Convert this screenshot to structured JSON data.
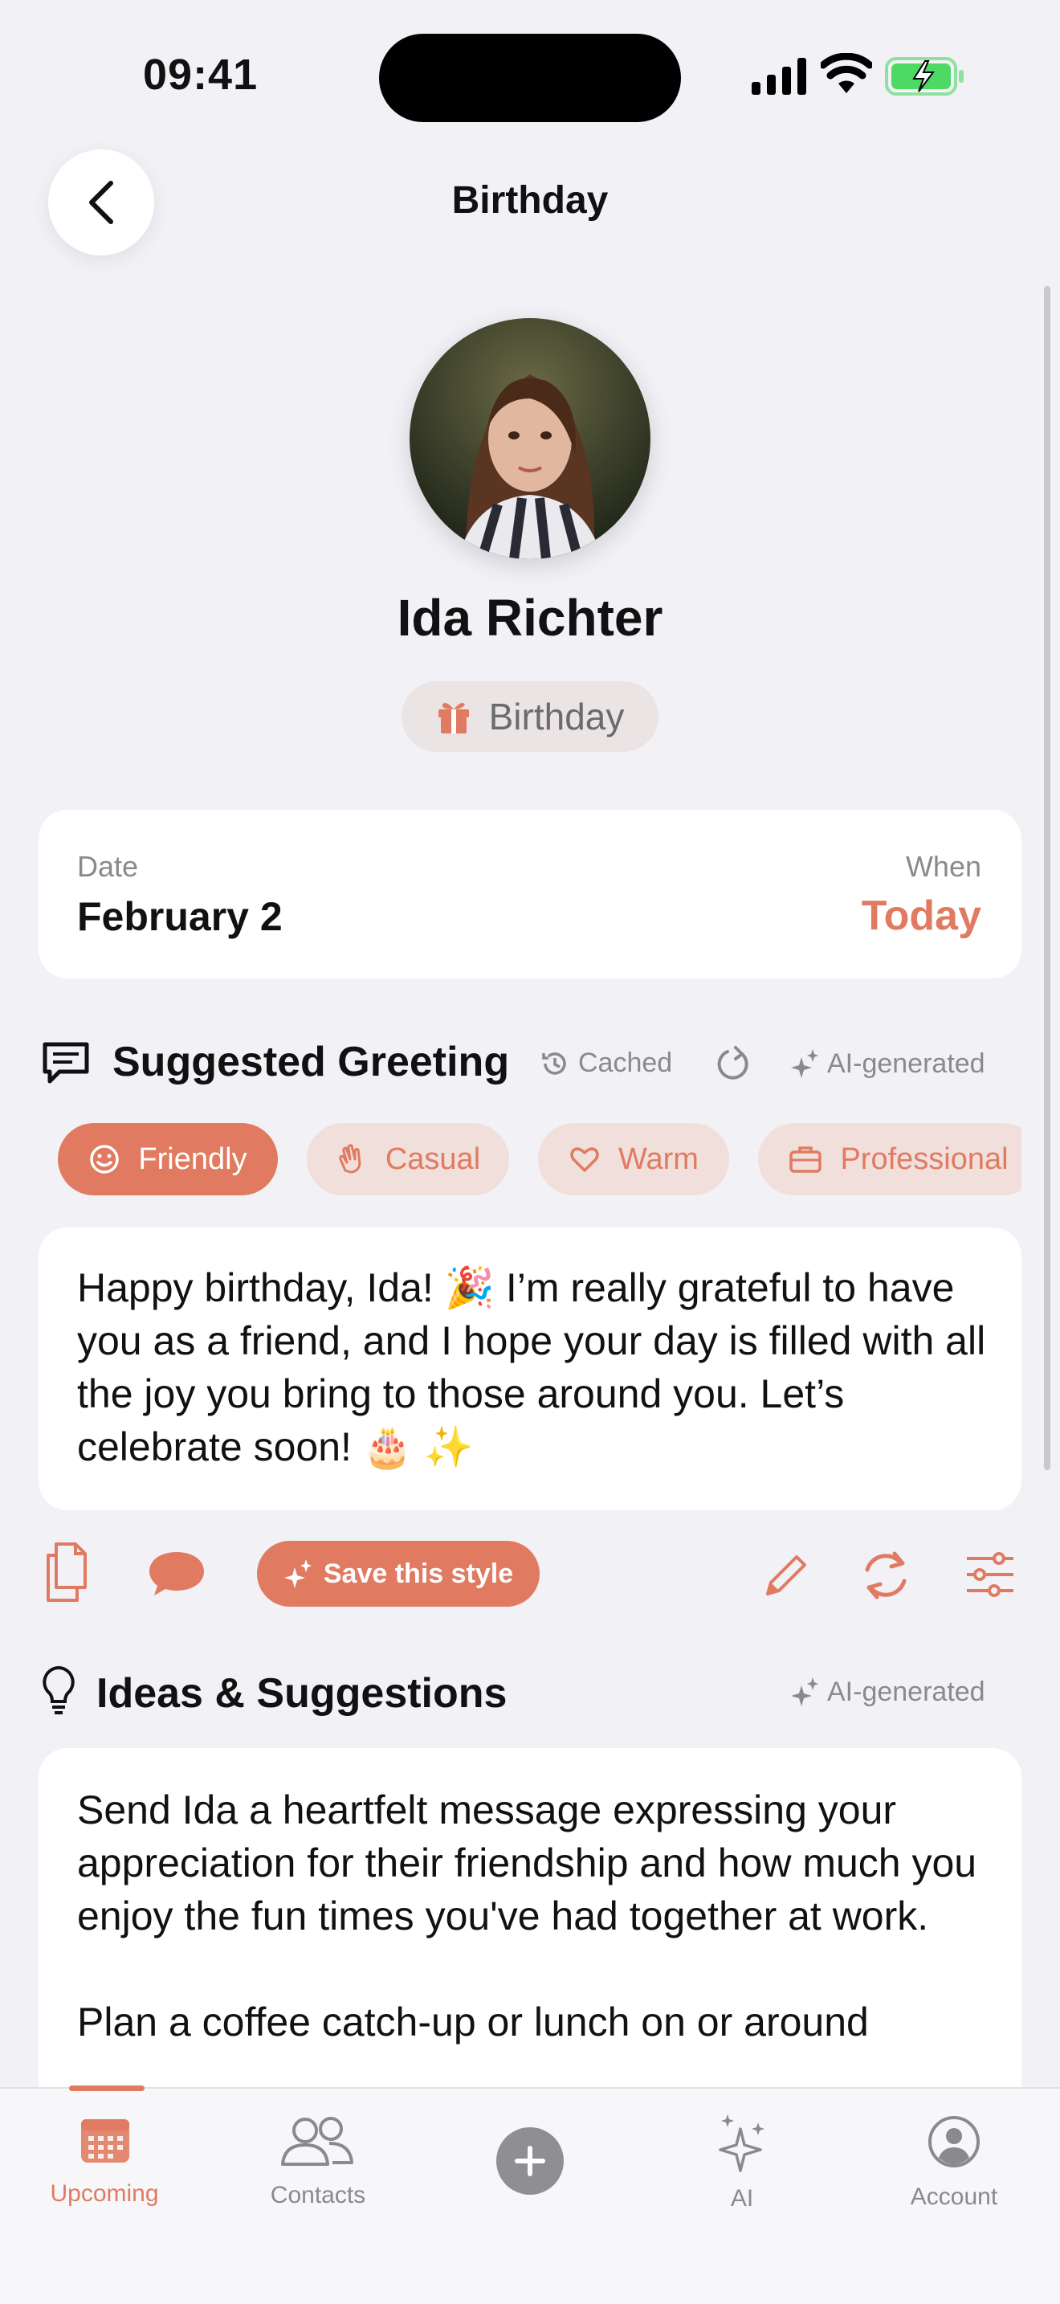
{
  "status_bar": {
    "time": "09:41"
  },
  "header": {
    "title": "Birthday"
  },
  "profile": {
    "name": "Ida Richter",
    "event_type": "Birthday"
  },
  "date_card": {
    "date_label": "Date",
    "date_value": "February 2",
    "when_label": "When",
    "when_value": "Today"
  },
  "greeting": {
    "section_title": "Suggested Greeting",
    "cached_label": "Cached",
    "ai_label": "AI-generated",
    "tones": [
      {
        "label": "Friendly",
        "icon": "smile-icon",
        "active": true
      },
      {
        "label": "Casual",
        "icon": "wave-hand-icon",
        "active": false
      },
      {
        "label": "Warm",
        "icon": "heart-icon",
        "active": false
      },
      {
        "label": "Professional",
        "icon": "briefcase-icon",
        "active": false
      }
    ],
    "text": "Happy birthday, Ida! 🎉 I’m really grateful to have you as a friend, and I hope your day is filled with all the joy you bring to those around you. Let’s celebrate soon! 🎂 ✨",
    "save_style_label": "Save this style"
  },
  "ideas": {
    "section_title": "Ideas & Suggestions",
    "ai_label": "AI-generated",
    "text": "Send Ida a heartfelt message expressing your appreciation for their friendship and how much you enjoy the fun times you've had together at work.\n\nPlan a coffee catch-up or lunch on or around"
  },
  "tabbar": {
    "items": [
      {
        "label": "Upcoming",
        "icon": "calendar-icon",
        "active": true
      },
      {
        "label": "Contacts",
        "icon": "people-icon",
        "active": false
      },
      {
        "label": "",
        "icon": "plus-icon",
        "active": false
      },
      {
        "label": "AI",
        "icon": "sparkles-icon",
        "active": false
      },
      {
        "label": "Account",
        "icon": "person-circle-icon",
        "active": false
      }
    ]
  },
  "colors": {
    "accent": "#e07b62",
    "accent_soft": "#f1dfdb",
    "background": "#f2f1f6",
    "muted": "#8a8a8e"
  }
}
